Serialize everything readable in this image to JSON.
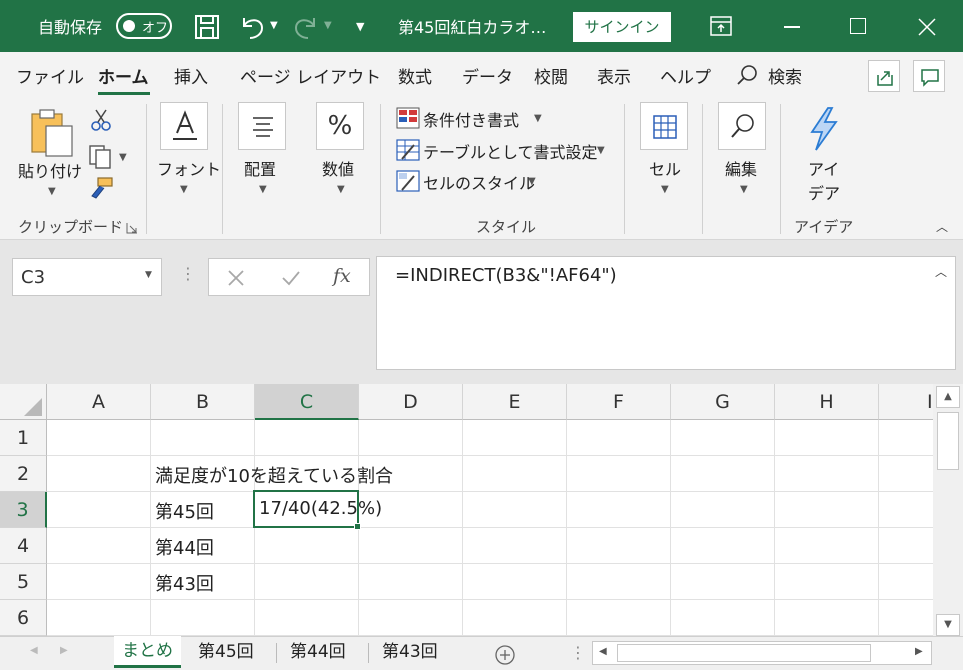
{
  "title_bar": {
    "autosave_label": "自動保存",
    "autosave_toggle": "オフ",
    "doc_title": "第45回紅白カラオ…",
    "signin_label": "サインイン"
  },
  "ribbon_tabs": [
    "ファイル",
    "ホーム",
    "挿入",
    "ページ レイアウト",
    "数式",
    "データ",
    "校閲",
    "表示",
    "ヘルプ",
    "検索"
  ],
  "ribbon": {
    "paste_label": "貼り付け",
    "clipboard_group": "クリップボード",
    "font_label": "フォント",
    "align_label": "配置",
    "number_label": "数値",
    "cond_format": "条件付き書式",
    "table_format": "テーブルとして書式設定",
    "cell_styles": "セルのスタイル",
    "styles_group": "スタイル",
    "cells_label": "セル",
    "edit_label": "編集",
    "ideas_label_1": "アイ",
    "ideas_label_2": "デア",
    "ideas_group": "アイデア"
  },
  "formula_bar": {
    "name_box": "C3",
    "fx": "fx",
    "formula": "=INDIRECT(B3&\"!AF64\")"
  },
  "grid": {
    "columns": [
      "A",
      "B",
      "C",
      "D",
      "E",
      "F",
      "G",
      "H",
      "I"
    ],
    "rows": [
      "1",
      "2",
      "3",
      "4",
      "5",
      "6"
    ],
    "cells": {
      "B2": "満足度が10を超えている割合",
      "B3": "第45回",
      "C3": "17/40(42.5%)",
      "B4": "第44回",
      "B5": "第43回"
    },
    "active_cell": "C3"
  },
  "sheet_tabs": [
    "まとめ",
    "第45回",
    "第44回",
    "第43回"
  ],
  "active_sheet": "まとめ",
  "colors": {
    "excel_green": "#217346",
    "active_border": "#217346"
  }
}
